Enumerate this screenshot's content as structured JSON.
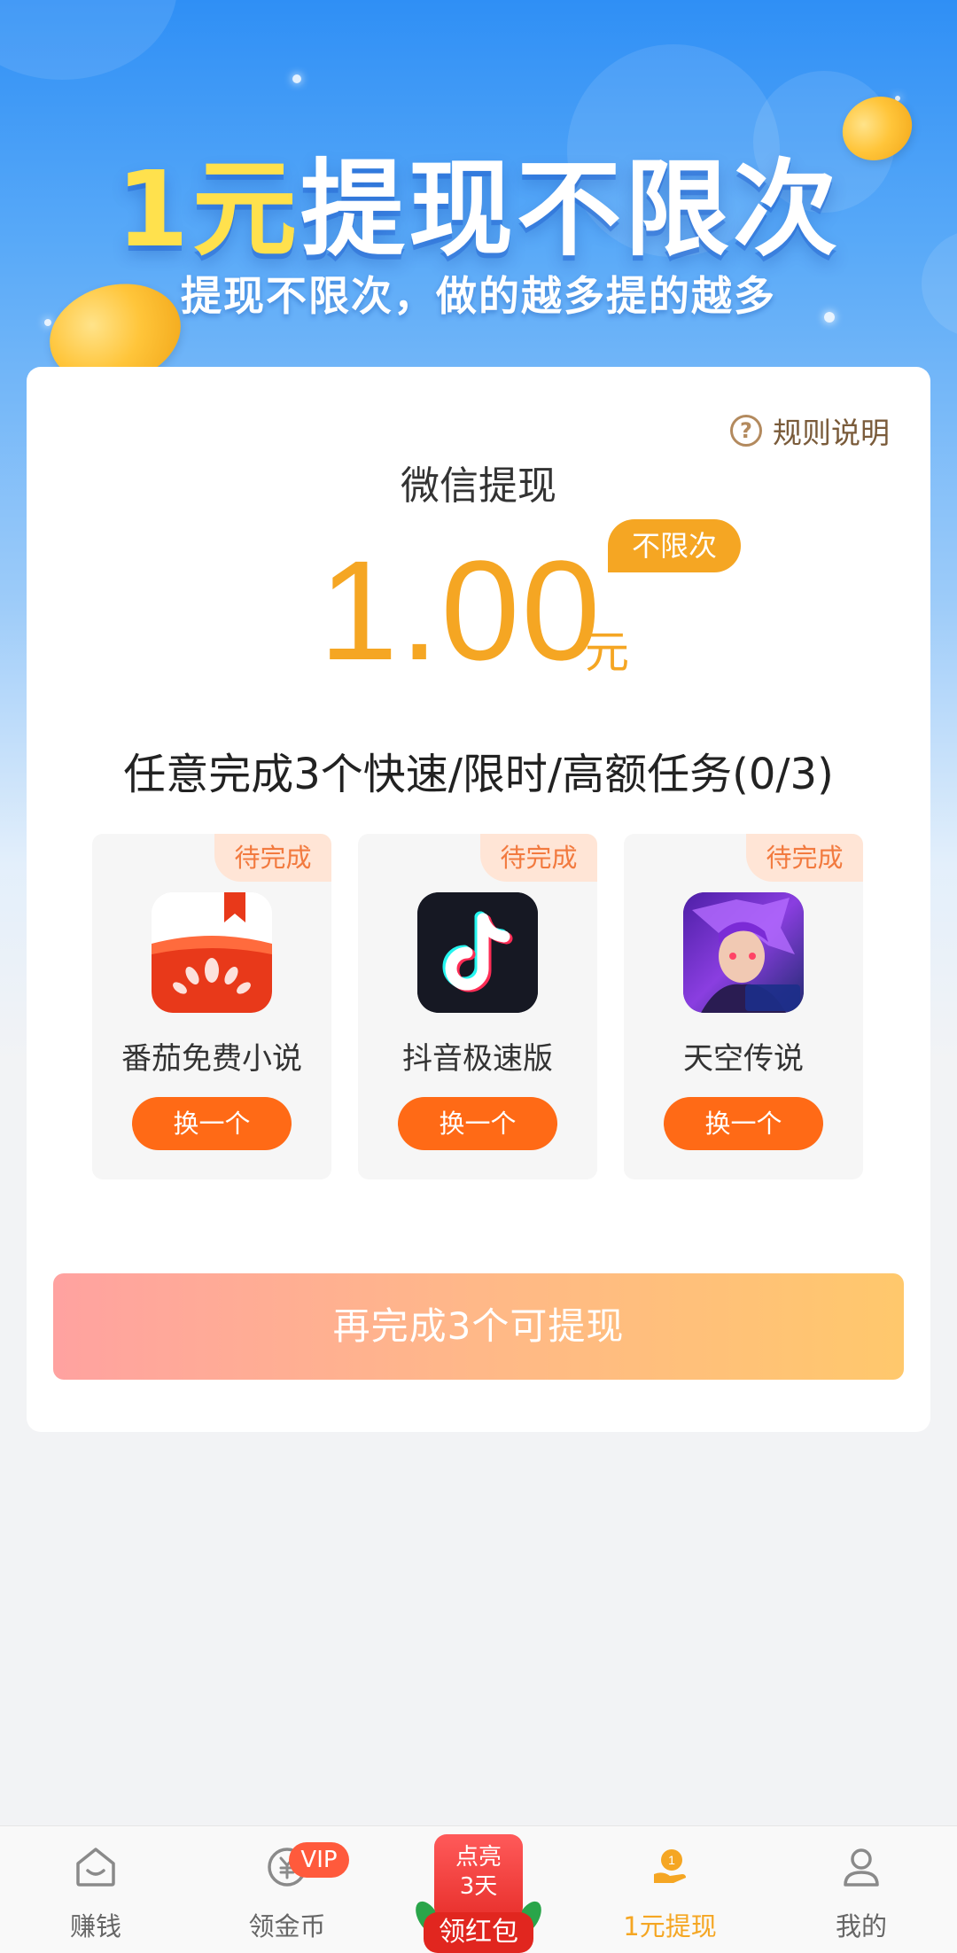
{
  "banner": {
    "headline_accent": "1元",
    "headline_rest": "提现不限次",
    "subline": "提现不限次，做的越多提的越多"
  },
  "card": {
    "rules_icon": "question-circle-icon",
    "rules_label": "规则说明",
    "method_title": "微信提现",
    "amount": "1.00",
    "unit": "元",
    "limit_badge": "不限次",
    "task_title": "任意完成3个快速/限时/高额任务(0/3)",
    "tasks": [
      {
        "status": "待完成",
        "name": "番茄免费小说",
        "swap_label": "换一个",
        "icon": "fanqie-novel-app-icon"
      },
      {
        "status": "待完成",
        "name": "抖音极速版",
        "swap_label": "换一个",
        "icon": "douyin-lite-app-icon"
      },
      {
        "status": "待完成",
        "name": "天空传说",
        "swap_label": "换一个",
        "icon": "tiankong-legend-app-icon"
      }
    ],
    "cta_label": "再完成3个可提现"
  },
  "promo": {
    "line1": "点亮",
    "line2": "3天",
    "banner": "领红包"
  },
  "tabbar": {
    "items": [
      {
        "label": "赚钱",
        "icon": "house-icon"
      },
      {
        "label": "领金币",
        "icon": "coin-icon",
        "badge": "VIP"
      },
      {
        "label": "1元提现",
        "icon": "withdraw-coin-icon",
        "active": true
      },
      {
        "label": "我的",
        "icon": "user-icon"
      }
    ]
  },
  "colors": {
    "accent_orange": "#f5a623",
    "button_orange": "#ff6a16",
    "banner_blue": "#2f8ff5"
  }
}
